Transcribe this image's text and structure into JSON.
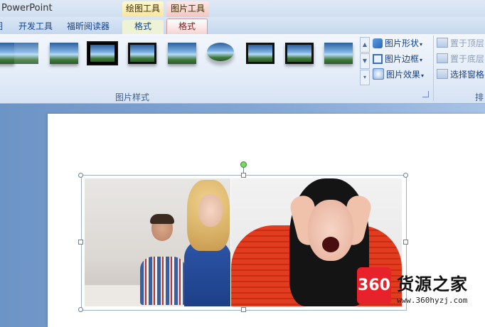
{
  "window": {
    "title": "PowerPoint"
  },
  "context_tabs": {
    "drawing_tools": "绘图工具",
    "picture_tools": "图片工具"
  },
  "tabs": [
    {
      "label": "图"
    },
    {
      "label": "开发工具"
    },
    {
      "label": "福昕阅读器"
    },
    {
      "label": "格式"
    },
    {
      "label": "格式",
      "active": true
    }
  ],
  "ribbon": {
    "picture_styles": {
      "label": "图片样式",
      "picture_shape": "图片形状",
      "picture_border": "图片边框",
      "picture_effects": "图片效果"
    },
    "arrange": {
      "label": "排",
      "bring_to_front": "置于顶层",
      "send_to_back": "置于底层",
      "selection_pane": "选择窗格"
    }
  },
  "icons": {
    "picture_shape": "shape-icon",
    "picture_border": "border-icon",
    "picture_effects": "effects-icon",
    "dropdown": "chevron-down-icon"
  },
  "colors": {
    "active_tab": "#f4d2d0",
    "ribbon": "#e3ecf8",
    "workspace": "#86a9d6"
  },
  "watermark": {
    "logo": "360",
    "title": "货源之家",
    "url": "www.360hyzj.com"
  }
}
